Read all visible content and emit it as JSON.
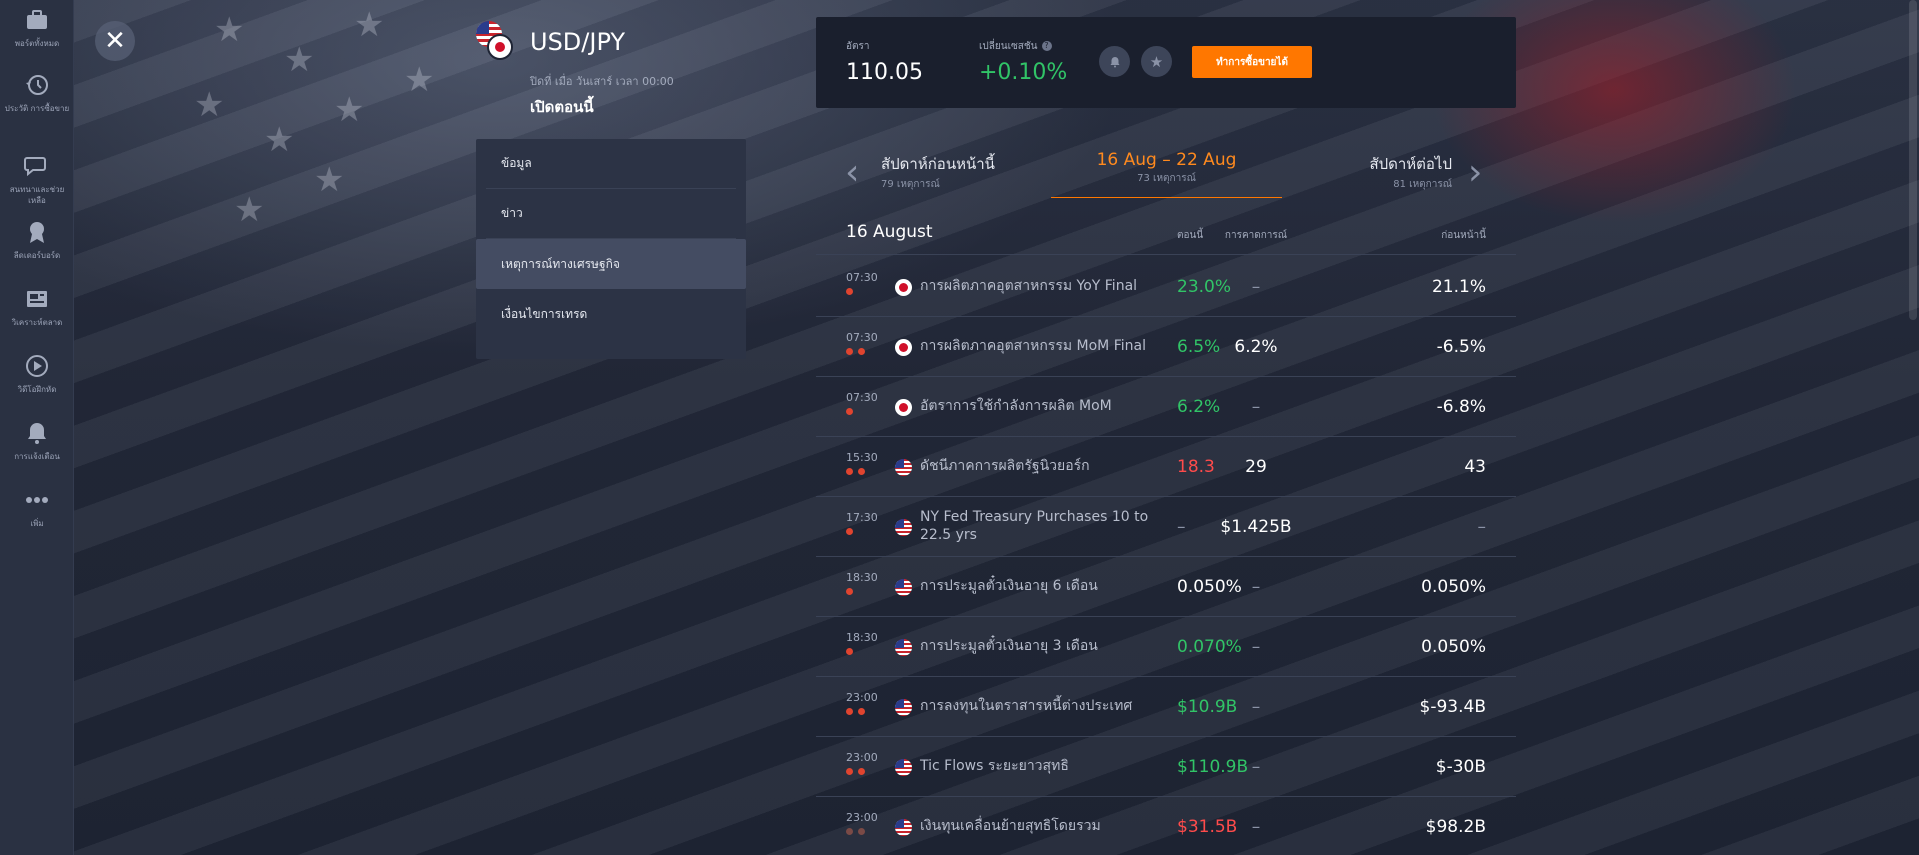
{
  "sidebar": {
    "items": [
      {
        "label": "พอร์ตทั้งหมด",
        "icon": "briefcase-icon"
      },
      {
        "label": "ประวัติ การซื้อขาย",
        "icon": "history-icon"
      },
      {
        "label": "สนทนาและช่วยเหลือ",
        "icon": "chat-icon"
      },
      {
        "label": "ลีดเดอร์บอร์ด",
        "icon": "award-icon"
      },
      {
        "label": "วิเคราะห์ตลาด",
        "icon": "news-icon"
      },
      {
        "label": "วิดีโอฝึกหัด",
        "icon": "play-icon"
      },
      {
        "label": "การแจ้งเตือน",
        "icon": "bell-icon"
      },
      {
        "label": "เพิ่ม",
        "icon": "more-icon"
      }
    ]
  },
  "asset": {
    "name": "USD/JPY",
    "closed_text": "ปิดที่ เมื่อ วันเสาร์ เวลา 00:00",
    "open_text": "เปิดตอนนี้"
  },
  "menu": {
    "items": [
      "ข้อมูล",
      "ข่าว",
      "เหตุการณ์ทางเศรษฐกิจ",
      "เงื่อนไขการเทรด"
    ],
    "active_index": 2
  },
  "quote": {
    "rate_label": "อัตรา",
    "rate_value": "110.05",
    "change_label": "เปลี่ยนเซสชัน",
    "change_value": "+0.10%",
    "trade_button": "ทำการซื้อขายได้"
  },
  "week_nav": {
    "prev_title": "สัปดาห์ก่อนหน้านี้",
    "prev_sub": "79 เหตุการณ์",
    "current_title": "16 Aug – 22 Aug",
    "current_sub": "73 เหตุการณ์",
    "next_title": "สัปดาห์ต่อไป",
    "next_sub": "81 เหตุการณ์"
  },
  "table": {
    "day_title": "16 August",
    "col_actual": "ตอนนี้",
    "col_forecast": "การคาดการณ์",
    "col_previous": "ก่อนหน้านี้",
    "rows": [
      {
        "time": "07:30",
        "importance": 1,
        "country": "jp",
        "name": "การผลิตภาคอุตสาหกรรม YoY Final",
        "actual": "23.0%",
        "actual_color": "green",
        "forecast": "–",
        "previous": "21.1%"
      },
      {
        "time": "07:30",
        "importance": 2,
        "country": "jp",
        "name": "การผลิตภาคอุตสาหกรรม MoM Final",
        "actual": "6.5%",
        "actual_color": "green",
        "forecast": "6.2%",
        "previous": "-6.5%"
      },
      {
        "time": "07:30",
        "importance": 1,
        "country": "jp",
        "name": "อัตราการใช้กำลังการผลิต MoM",
        "actual": "6.2%",
        "actual_color": "green",
        "forecast": "–",
        "previous": "-6.8%"
      },
      {
        "time": "15:30",
        "importance": 2,
        "country": "us",
        "name": "ดัชนีภาคการผลิตรัฐนิวยอร์ก",
        "actual": "18.3",
        "actual_color": "red",
        "forecast": "29",
        "previous": "43"
      },
      {
        "time": "17:30",
        "importance": 1,
        "country": "us",
        "name": "NY Fed Treasury Purchases 10 to 22.5 yrs",
        "actual": "–",
        "actual_color": "dash",
        "forecast": "$1.425B",
        "previous": "–"
      },
      {
        "time": "18:30",
        "importance": 1,
        "country": "us",
        "name": "การประมูลตั๋วเงินอายุ 6 เดือน",
        "actual": "0.050%",
        "actual_color": "white",
        "forecast": "–",
        "previous": "0.050%"
      },
      {
        "time": "18:30",
        "importance": 1,
        "country": "us",
        "name": "การประมูลตั๋วเงินอายุ 3 เดือน",
        "actual": "0.070%",
        "actual_color": "green",
        "forecast": "–",
        "previous": "0.050%"
      },
      {
        "time": "23:00",
        "importance": 2,
        "country": "us",
        "name": "การลงทุนในตราสารหนี้ต่างประเทศ",
        "actual": "$10.9B",
        "actual_color": "green",
        "forecast": "–",
        "previous": "$-93.4B"
      },
      {
        "time": "23:00",
        "importance": 2,
        "country": "us",
        "name": "Tic Flows ระยะยาวสุทธิ",
        "actual": "$110.9B",
        "actual_color": "green",
        "forecast": "–",
        "previous": "$-30B"
      },
      {
        "time": "23:00",
        "importance": 2,
        "country": "us",
        "name": "เงินทุนเคลื่อนย้ายสุทธิโดยรวม",
        "actual": "$31.5B",
        "actual_color": "red",
        "forecast": "–",
        "previous": "$98.2B"
      }
    ]
  }
}
